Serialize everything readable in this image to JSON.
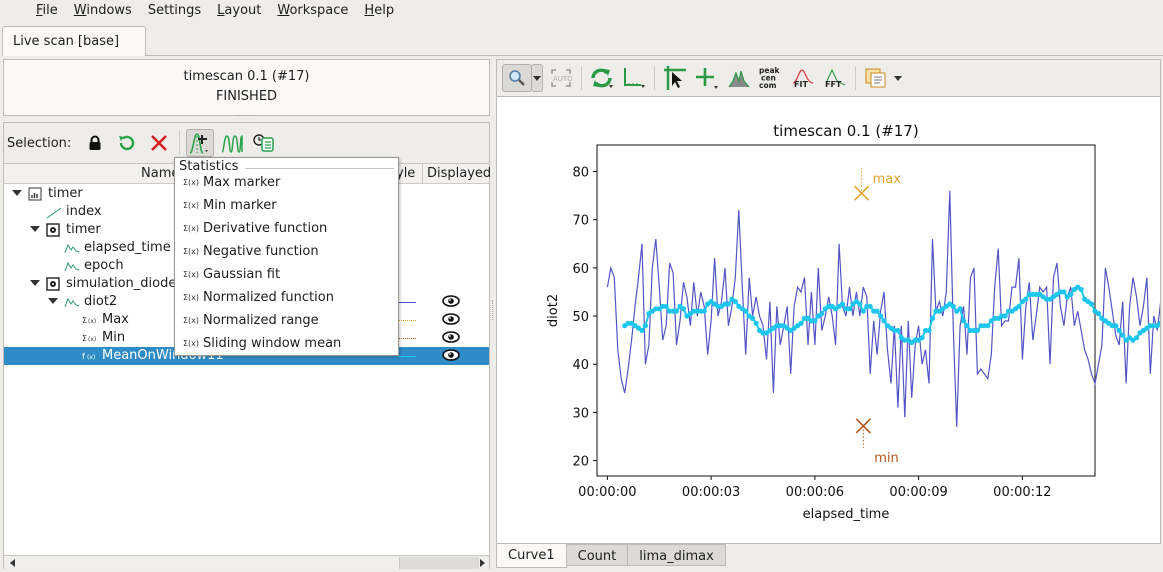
{
  "menubar": [
    {
      "label": "File",
      "accel": "F",
      "rest": "ile"
    },
    {
      "label": "Windows",
      "accel": "W",
      "rest": "indows"
    },
    {
      "label": "Settings",
      "accel": "",
      "rest": "Settings"
    },
    {
      "label": "Layout",
      "accel": "L",
      "rest": "ayout"
    },
    {
      "label": "Workspace",
      "accel": "W",
      "rest": "orkspace"
    },
    {
      "label": "Help",
      "accel": "H",
      "rest": "elp"
    }
  ],
  "main_tab": "Live scan [base]",
  "scan": {
    "title": "timescan 0.1 (#17)",
    "state": "FINISHED"
  },
  "selection": {
    "label": "Selection:",
    "buttons": [
      "lock",
      "reset",
      "remove",
      "add-statistics",
      "filters",
      "time-tools"
    ]
  },
  "tree": {
    "columns": {
      "name": "Name",
      "style": "yle",
      "displayed": "Displayed"
    },
    "rows": [
      {
        "label": "timer",
        "icon": "device-icon",
        "level": 0,
        "expanded": true
      },
      {
        "label": "index",
        "icon": "axis-icon",
        "level": 1
      },
      {
        "label": "timer",
        "icon": "controller-icon",
        "level": 1,
        "expanded": true
      },
      {
        "label": "elapsed_time",
        "icon": "channel-icon",
        "level": 2
      },
      {
        "label": "epoch",
        "icon": "channel-icon",
        "level": 2
      },
      {
        "label": "simulation_diode_",
        "icon": "controller-icon",
        "level": 1,
        "expanded": true
      },
      {
        "label": "diot2",
        "icon": "channel-icon",
        "level": 2,
        "expanded": true,
        "style": "solid",
        "style_color": "#5454c6",
        "displayed": true
      },
      {
        "label": "Max",
        "icon": "stat-icon",
        "level": 3,
        "style": "dotted",
        "style_color": "#e3a431",
        "displayed": true
      },
      {
        "label": "Min",
        "icon": "stat-icon",
        "level": 3,
        "style": "dotted",
        "style_color": "#b0561c",
        "displayed": true
      },
      {
        "label": "MeanOnWindow11",
        "icon": "function-icon",
        "level": 3,
        "style": "solid",
        "style_color": "#1ec6ee",
        "displayed": true,
        "selected": true
      }
    ]
  },
  "popup": {
    "section": "Statistics",
    "items": [
      "Max marker",
      "Min marker",
      "Derivative function",
      "Negative function",
      "Gaussian fit",
      "Normalized function",
      "Normalized range",
      "Sliding window mean"
    ]
  },
  "plot_toolbar": [
    "zoom",
    "zoom-menu",
    "autoscale",
    "refresh",
    "axis-options",
    "crosshair",
    "add-marker",
    "peak",
    "peak-cen-com",
    "fit",
    "fft",
    "copy-menu"
  ],
  "plot_toolbar_text": {
    "pcc": [
      "peak",
      "cen",
      "com"
    ],
    "fit": "FIT",
    "fft": "FFT"
  },
  "bottom_tabs": [
    {
      "label": "Curve1",
      "active": true
    },
    {
      "label": "Count"
    },
    {
      "label": "lima_dimax"
    }
  ],
  "chart_data": {
    "type": "line",
    "title": "timescan 0.1 (#17)",
    "xlabel": "elapsed_time",
    "ylabel": "diot2",
    "xlim": [
      -0.3,
      14.1
    ],
    "ylim": [
      16.8,
      85.5
    ],
    "xticks": [
      {
        "v": 0,
        "label": "00:00:00"
      },
      {
        "v": 3,
        "label": "00:00:03"
      },
      {
        "v": 6,
        "label": "00:00:06"
      },
      {
        "v": 9,
        "label": "00:00:09"
      },
      {
        "v": 12,
        "label": "00:00:12"
      }
    ],
    "yticks": [
      20,
      30,
      40,
      50,
      60,
      70,
      80
    ],
    "series": [
      {
        "name": "diot2",
        "color": "#5454c6",
        "x_step": 0.1,
        "values": [
          56,
          60,
          58,
          43,
          37,
          34,
          39,
          45,
          52,
          58,
          65,
          40,
          44,
          60,
          66,
          56,
          45,
          48,
          61,
          59,
          44,
          49,
          57,
          54,
          48,
          57,
          50,
          55,
          52,
          42,
          49,
          62,
          50,
          53,
          60,
          48,
          52,
          58,
          72,
          56,
          42,
          58,
          50,
          54,
          50,
          48,
          41,
          53,
          34,
          52,
          44,
          48,
          52,
          38,
          52,
          56,
          55,
          58,
          44,
          55,
          44,
          60,
          47,
          50,
          54,
          50,
          44,
          65,
          52,
          50,
          56,
          50,
          55,
          50,
          56,
          54,
          38,
          49,
          42,
          51,
          55,
          43,
          36,
          48,
          31,
          48,
          29,
          49,
          33,
          44,
          48,
          40,
          43,
          36,
          66,
          51,
          53,
          50,
          55,
          76,
          48,
          27,
          48,
          52,
          42,
          58,
          60,
          38,
          39,
          38,
          37,
          42,
          56,
          64,
          48,
          49,
          49,
          56,
          56,
          62,
          41,
          52,
          57,
          45,
          50,
          56,
          55,
          56,
          40,
          58,
          61,
          52,
          48,
          54,
          56,
          48,
          51,
          47,
          43,
          41,
          38,
          36,
          40,
          44,
          60,
          56,
          51,
          46,
          44,
          53,
          36,
          52,
          58,
          54,
          48,
          52,
          58,
          38,
          50,
          47,
          53,
          58,
          63,
          63,
          52,
          50,
          53,
          51,
          52,
          50
        ]
      },
      {
        "name": "MeanOnWindow11",
        "color": "#1ec6ee",
        "x_start": 0.5,
        "x_step": 0.1,
        "values": [
          48,
          48.5,
          48.5,
          48,
          47.5,
          47,
          48,
          50.5,
          51,
          51.5,
          51.5,
          52,
          52,
          51,
          51,
          51,
          52,
          51.5,
          50,
          50.5,
          51,
          51,
          51,
          51,
          52.5,
          53,
          52.5,
          52,
          52,
          52.5,
          52.5,
          53.5,
          53,
          52,
          51.5,
          51,
          50,
          49.5,
          48.5,
          47,
          46.5,
          46.5,
          47,
          47.5,
          48,
          48,
          48,
          47.5,
          47,
          47.5,
          48,
          48.5,
          49.5,
          49.5,
          49,
          49,
          50,
          50.5,
          51.5,
          52,
          52,
          51.5,
          52,
          52.5,
          51.5,
          51.5,
          52.5,
          53,
          52.5,
          51,
          52,
          52,
          51,
          51,
          50,
          49,
          48,
          47.5,
          47,
          47,
          45.5,
          45,
          45,
          44.5,
          45,
          45,
          45.5,
          47,
          47,
          49.5,
          51,
          51,
          51.5,
          52,
          52.5,
          52,
          51,
          51.5,
          49,
          48,
          47,
          47,
          47,
          48,
          48,
          48,
          49,
          49.5,
          49.5,
          50,
          50,
          51,
          51,
          51.5,
          52,
          53,
          53.5,
          54.5,
          54.5,
          54.5,
          54.5,
          54,
          53.5,
          53.5,
          54,
          54.5,
          55,
          55,
          54,
          54.5,
          55.5,
          56,
          55.5,
          53.5,
          53,
          52.5,
          51,
          50.5,
          49.5,
          49,
          48.5,
          48,
          48,
          47,
          46,
          45,
          45.5,
          45,
          45.5,
          46.5,
          47,
          47.5,
          48,
          48,
          48,
          48.5,
          49,
          49,
          49.5,
          50,
          50.5,
          51.5,
          52.5,
          53,
          52.5,
          52,
          52,
          52
        ]
      }
    ],
    "markers": [
      {
        "name": "max",
        "x": 7.35,
        "y": 75.5,
        "color": "#e3a431"
      },
      {
        "name": "min",
        "x": 7.4,
        "y": 27.2,
        "color": "#b0561c"
      }
    ]
  }
}
